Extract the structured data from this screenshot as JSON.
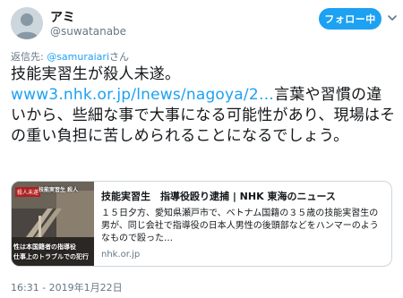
{
  "user": {
    "display_name": "アミ",
    "handle": "@suwatanabe"
  },
  "follow_button": {
    "label": "フォロー中"
  },
  "reply_to": {
    "prefix": "返信先: ",
    "user": "@samuraiari",
    "suffix": "さん"
  },
  "tweet": {
    "text_before_link": "技能実習生が殺人未遂。",
    "link": "www3.nhk.or.jp/lnews/nagoya/2…",
    "text_after_link": "言葉や習慣の違いから、些細な事で大事になる可能性があり、現場はその重い負担に苦しめられることになるでしょう。"
  },
  "card": {
    "thumb_tag": "殺人未遂",
    "thumb_caption_top": "技能実習生 殺人",
    "thumb_caption_1": "性は本国籍者の指導役",
    "thumb_caption_2": "仕事上のトラブルでの犯行",
    "title": "技能実習生　指導役殴り逮捕 | NHK 東海のニュース",
    "description": "１５日夕方、愛知県瀬戸市で、ベトナム国籍の３５歳の技能実習生の男が、同じ会社で指導役の日本人男性の後頭部などをハンマーのようなもので殴った…",
    "domain": "nhk.or.jp"
  },
  "timestamp": "16:31 - 2019年1月22日",
  "colors": {
    "accent": "#1da1f2",
    "muted": "#657786",
    "text": "#14171a"
  }
}
